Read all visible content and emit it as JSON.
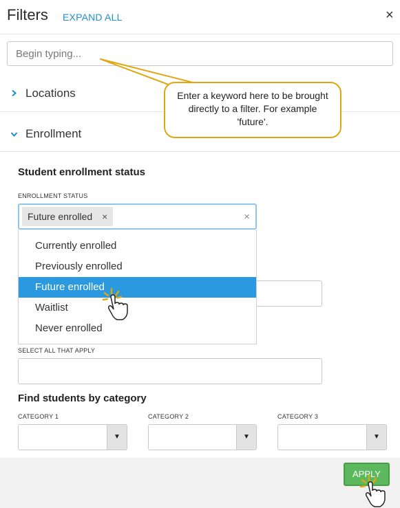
{
  "header": {
    "title": "Filters",
    "expand_all": "EXPAND ALL",
    "close_icon": "×"
  },
  "search": {
    "placeholder": "Begin typing..."
  },
  "sections": [
    {
      "label": "Locations",
      "expanded": false,
      "icon": "chevron-right-icon"
    },
    {
      "label": "Enrollment",
      "expanded": true,
      "icon": "chevron-down-icon"
    }
  ],
  "enrollment": {
    "heading": "Student enrollment status",
    "status_label": "ENROLLMENT STATUS",
    "selected_tag": "Future enrolled",
    "tag_remove": "×",
    "clear_all": "×",
    "options": [
      "Currently enrolled",
      "Previously enrolled",
      "Future enrolled",
      "Waitlist",
      "Never enrolled"
    ],
    "highlighted_option": "Future enrolled",
    "select_all_label": "SELECT ALL THAT APPLY"
  },
  "category": {
    "heading": "Find students by category",
    "labels": [
      "CATEGORY 1",
      "CATEGORY 2",
      "CATEGORY 3"
    ],
    "arrow": "▼"
  },
  "footer": {
    "apply": "APPLY"
  },
  "callout": {
    "text": "Enter a keyword here to be brought directly to a filter. For example 'future'."
  },
  "colors": {
    "link": "#1e8fd0",
    "highlight": "#2a99df",
    "apply_green": "#5cb85c",
    "callout_border": "#e0a611"
  }
}
